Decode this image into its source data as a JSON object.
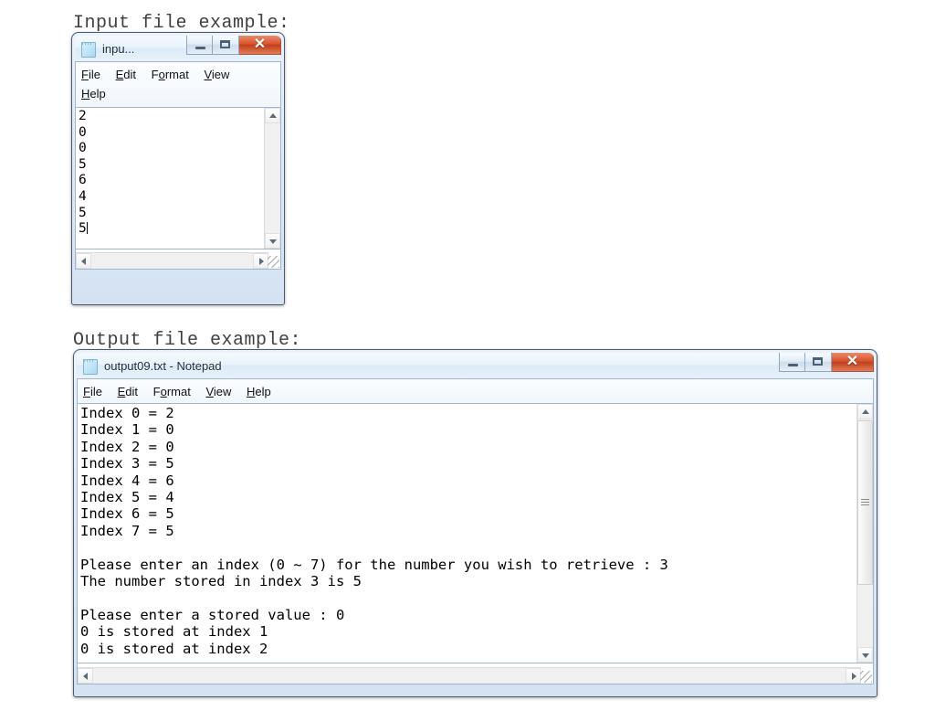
{
  "captions": {
    "input": "Input file example:",
    "output": "Output file example:"
  },
  "icons": {
    "notepad": "notepad-document-icon",
    "minimize": "minimize-icon",
    "maximize": "maximize-icon",
    "close": "close-icon",
    "close_glyph": "✕",
    "scroll_up": "scroll-up-arrow-icon",
    "scroll_down": "scroll-down-arrow-icon",
    "scroll_left": "scroll-left-arrow-icon",
    "scroll_right": "scroll-right-arrow-icon",
    "resize_grip": "resize-grip-icon"
  },
  "colors": {
    "close_button": "#d9542f",
    "window_frame": "#4a5a6a",
    "titlebar_top": "#f4f9fd",
    "menubar": "#fbfdff",
    "editor_bg": "#ffffff",
    "text": "#000000",
    "caption_text": "#404040",
    "scrollbar_track": "#f0f0f0"
  },
  "input_window": {
    "title": "inpu...",
    "menu": [
      {
        "label": "File",
        "pre": "F",
        "mnemonic": "F",
        "post": "ile"
      },
      {
        "label": "Edit",
        "pre": "E",
        "mnemonic": "E",
        "post": "dit"
      },
      {
        "label": "Format",
        "pre": "F",
        "mnemonic": "o",
        "post": "rmat"
      },
      {
        "label": "View",
        "pre": "V",
        "mnemonic": "V",
        "post": "iew"
      },
      {
        "label": "Help",
        "pre": "H",
        "mnemonic": "H",
        "post": "elp"
      }
    ],
    "content": "2\n0\n0\n5\n6\n4\n5\n5",
    "has_caret": true,
    "buttons": {
      "minimize": "Minimize",
      "maximize": "Maximize",
      "close": "Close"
    }
  },
  "output_window": {
    "title": "output09.txt - Notepad",
    "menu": [
      {
        "label": "File",
        "mnemonic": "F",
        "post": "ile"
      },
      {
        "label": "Edit",
        "mnemonic": "E",
        "post": "dit"
      },
      {
        "label": "Format",
        "pre": "F",
        "mnemonic": "o",
        "post": "rmat"
      },
      {
        "label": "View",
        "mnemonic": "V",
        "post": "iew"
      },
      {
        "label": "Help",
        "mnemonic": "H",
        "post": "elp"
      }
    ],
    "content": "Index 0 = 2\nIndex 1 = 0\nIndex 2 = 0\nIndex 3 = 5\nIndex 4 = 6\nIndex 5 = 4\nIndex 6 = 5\nIndex 7 = 5\n\nPlease enter an index (0 ~ 7) for the number you wish to retrieve : 3\nThe number stored in index 3 is 5\n\nPlease enter a stored value : 0\n0 is stored at index 1\n0 is stored at index 2",
    "buttons": {
      "minimize": "Minimize",
      "maximize": "Maximize",
      "close": "Close"
    }
  }
}
